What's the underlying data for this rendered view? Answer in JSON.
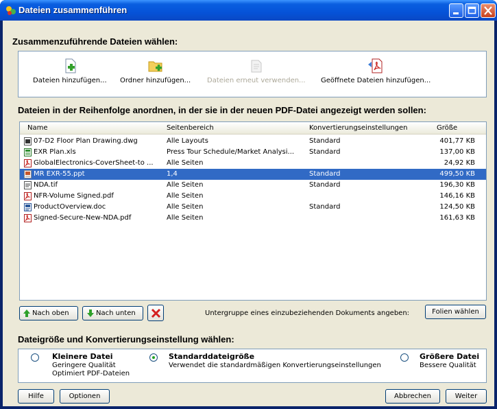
{
  "window": {
    "title": "Dateien zusammenführen"
  },
  "section1": {
    "heading": "Zusammenzuführende Dateien wählen:"
  },
  "toolbar": {
    "add_files": "Dateien hinzufügen...",
    "add_folder": "Ordner hinzufügen...",
    "reuse_files": "Dateien erneut verwenden...",
    "add_open_files": "Geöffnete Dateien hinzufügen..."
  },
  "section2": {
    "heading": "Dateien in der Reihenfolge anordnen, in der sie in der neuen PDF-Datei angezeigt werden sollen:"
  },
  "file_list": {
    "columns": [
      "Name",
      "Seitenbereich",
      "Konvertierungseinstellungen",
      "Größe"
    ],
    "rows": [
      {
        "name": "07-D2 Floor Plan Drawing.dwg",
        "range": "Alle Layouts",
        "conv": "Standard",
        "size": "401,77 KB",
        "icon": "dwg-file-icon"
      },
      {
        "name": "EXR Plan.xls",
        "range": "Press Tour Schedule/Market Analysi...",
        "conv": "Standard",
        "size": "137,00 KB",
        "icon": "excel-file-icon"
      },
      {
        "name": "GlobalElectronics-CoverSheet-to ...",
        "range": "Alle Seiten",
        "conv": "",
        "size": "24,92 KB",
        "icon": "pdf-file-icon"
      },
      {
        "name": "MR EXR-55.ppt",
        "range": "1,4",
        "conv": "Standard",
        "size": "499,50 KB",
        "icon": "ppt-file-icon",
        "selected": true
      },
      {
        "name": "NDA.tif",
        "range": "Alle Seiten",
        "conv": "Standard",
        "size": "196,30 KB",
        "icon": "tif-file-icon"
      },
      {
        "name": "NFR-Volume Signed.pdf",
        "range": "Alle Seiten",
        "conv": "",
        "size": "146,16 KB",
        "icon": "pdf-file-icon"
      },
      {
        "name": "ProductOverview.doc",
        "range": "Alle Seiten",
        "conv": "Standard",
        "size": "124,50 KB",
        "icon": "word-file-icon"
      },
      {
        "name": "Signed-Secure-New-NDA.pdf",
        "range": "Alle Seiten",
        "conv": "",
        "size": "161,63 KB",
        "icon": "pdf-file-icon"
      }
    ]
  },
  "list_actions": {
    "move_up": "Nach oben",
    "move_down": "Nach unten",
    "subset_label": "Untergruppe eines einzubeziehenden Dokuments angeben:",
    "choose_slides": "Folien wählen"
  },
  "section3": {
    "heading": "Dateigröße und Konvertierungseinstellung wählen:"
  },
  "options": {
    "small": {
      "title": "Kleinere Datei",
      "line1": "Geringere Qualität",
      "line2": "Optimiert PDF-Dateien"
    },
    "default": {
      "title": "Standarddateigröße",
      "line1": "Verwendet die standardmäßigen Konvertierungseinstellungen",
      "selected": true
    },
    "large": {
      "title": "Größere Datei",
      "line1": "Bessere Qualität"
    }
  },
  "footer": {
    "help": "Hilfe",
    "options": "Optionen",
    "cancel": "Abbrechen",
    "next": "Weiter"
  },
  "colors": {
    "titlebar": "#0553d8",
    "selection": "#316ac5",
    "client_bg": "#ece9d8"
  }
}
